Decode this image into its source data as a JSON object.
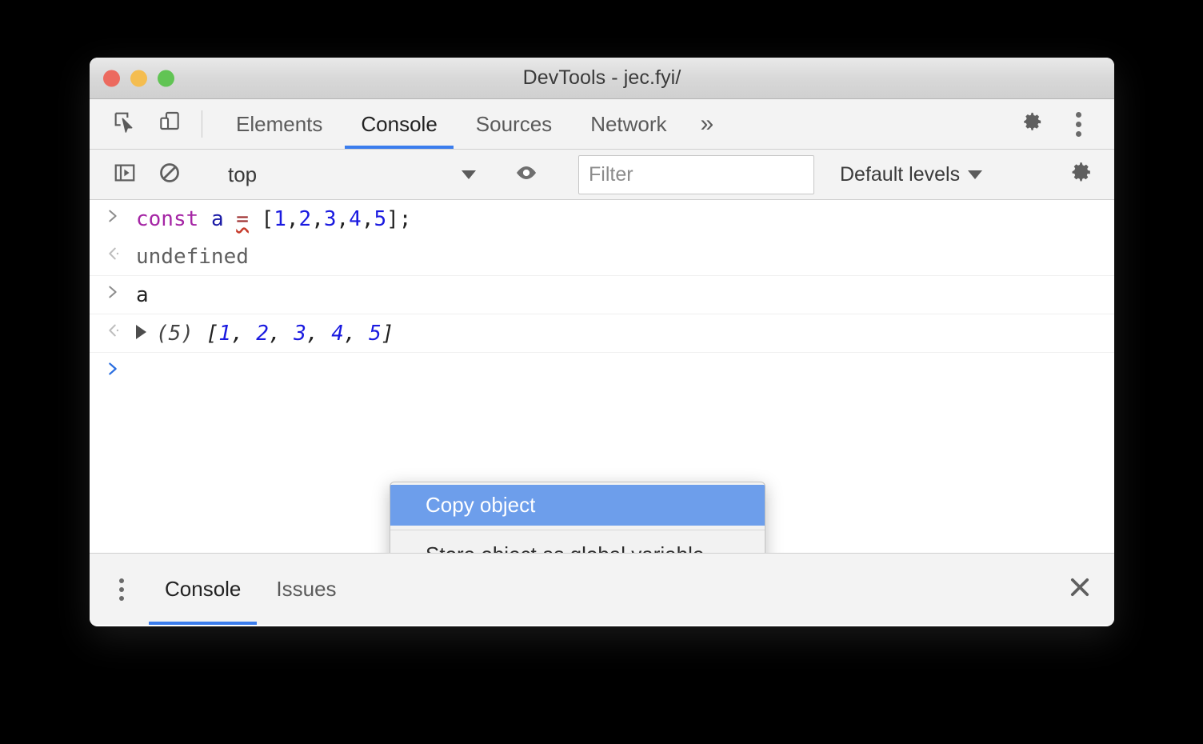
{
  "window": {
    "title": "DevTools - jec.fyi/",
    "traffic_lights": [
      "close-red",
      "minimize-yellow",
      "zoom-green"
    ],
    "colors": {
      "accent_blue": "#3b7ded",
      "menu_highlight": "#6d9eeb",
      "keyword_purple": "#a526a5",
      "number_blue": "#1a1ae0",
      "variable_blue": "#1a1aa6",
      "operator_red": "#9c2b2b",
      "traffic_red": "#ec6a5f",
      "traffic_yellow": "#f4bd50",
      "traffic_green": "#61c454"
    }
  },
  "toolbar": {
    "inspect_icon": "inspect-element-icon",
    "device_icon": "device-toolbar-icon",
    "tabs": [
      {
        "label": "Elements",
        "active": false
      },
      {
        "label": "Console",
        "active": true
      },
      {
        "label": "Sources",
        "active": false
      },
      {
        "label": "Network",
        "active": false
      }
    ],
    "more_tabs_label": "»",
    "settings_icon": "gear-icon",
    "more_options_icon": "kebab-menu-icon"
  },
  "console_toolbar": {
    "sidebar_toggle_icon": "console-sidebar-icon",
    "clear_icon": "clear-console-icon",
    "context_selector": {
      "value": "top",
      "caret_icon": "chevron-down-icon"
    },
    "live_expression_icon": "eye-icon",
    "filter": {
      "value": "",
      "placeholder": "Filter"
    },
    "levels": {
      "label": "Default levels",
      "caret_icon": "chevron-down-icon"
    },
    "settings_icon": "gear-icon"
  },
  "console": {
    "rows": [
      {
        "kind": "input",
        "gutter_icon": "input-prompt-arrow",
        "tokens": [
          {
            "text": "const",
            "type": "keyword"
          },
          {
            "text": " ",
            "type": "plain"
          },
          {
            "text": "a",
            "type": "variable"
          },
          {
            "text": " ",
            "type": "plain"
          },
          {
            "text": "=",
            "type": "operator"
          },
          {
            "text": " [",
            "type": "punct"
          },
          {
            "text": "1",
            "type": "number"
          },
          {
            "text": ",",
            "type": "punct"
          },
          {
            "text": "2",
            "type": "number"
          },
          {
            "text": ",",
            "type": "punct"
          },
          {
            "text": "3",
            "type": "number"
          },
          {
            "text": ",",
            "type": "punct"
          },
          {
            "text": "4",
            "type": "number"
          },
          {
            "text": ",",
            "type": "punct"
          },
          {
            "text": "5",
            "type": "number"
          },
          {
            "text": "];",
            "type": "punct"
          }
        ],
        "plain_text": "const a = [1,2,3,4,5];"
      },
      {
        "kind": "output",
        "gutter_icon": "output-result-arrow",
        "plain_text": "undefined"
      },
      {
        "kind": "input",
        "gutter_icon": "input-prompt-arrow",
        "plain_text": "a"
      },
      {
        "kind": "output-array",
        "gutter_icon": "output-result-arrow",
        "disclosure_icon": "disclosure-triangle-collapsed",
        "count_label": "(5)",
        "open_bracket": "[",
        "items": [
          "1",
          "2",
          "3",
          "4",
          "5"
        ],
        "separator": ", ",
        "close_bracket": "]",
        "plain_text": "(5) [1, 2, 3, 4, 5]"
      },
      {
        "kind": "prompt",
        "gutter_icon": "active-prompt-arrow",
        "plain_text": ""
      }
    ]
  },
  "context_menu": {
    "items": [
      {
        "label": "Copy object",
        "selected": true
      },
      {
        "label": "Store object as global variable",
        "selected": false
      }
    ]
  },
  "drawer": {
    "more_icon": "kebab-menu-icon",
    "tabs": [
      {
        "label": "Console",
        "active": true
      },
      {
        "label": "Issues",
        "active": false
      }
    ],
    "close_icon": "close-icon"
  }
}
